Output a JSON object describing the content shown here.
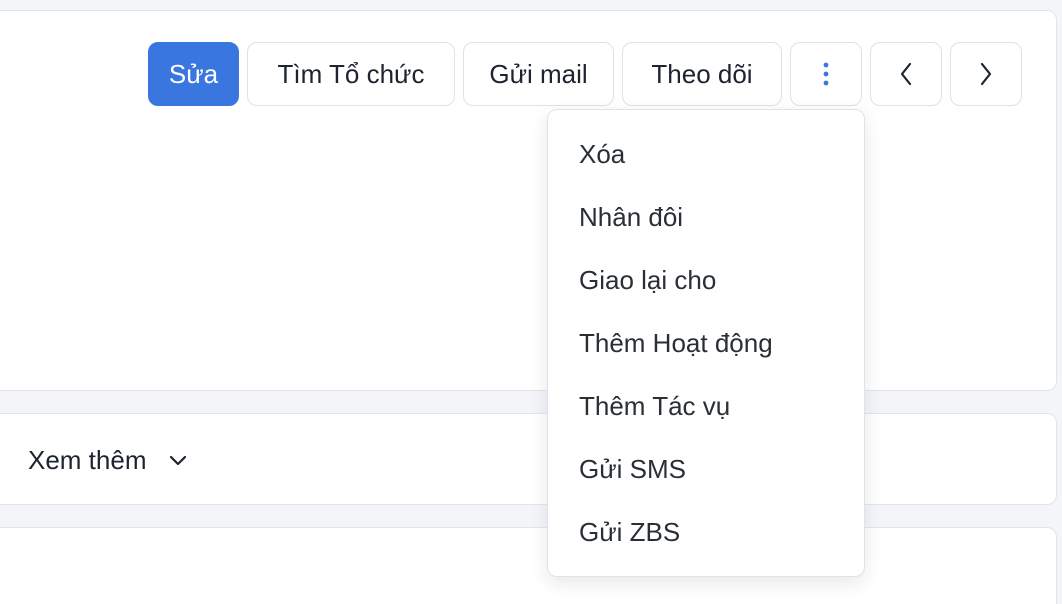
{
  "toolbar": {
    "edit_label": "Sửa",
    "find_org_label": "Tìm Tổ chức",
    "send_mail_label": "Gửi mail",
    "follow_label": "Theo dõi"
  },
  "section": {
    "see_more_label": "Xem thêm"
  },
  "dropdown": {
    "items": [
      {
        "label": "Xóa"
      },
      {
        "label": "Nhân đôi"
      },
      {
        "label": "Giao lại cho"
      },
      {
        "label": "Thêm Hoạt động"
      },
      {
        "label": "Thêm Tác vụ"
      },
      {
        "label": "Gửi SMS"
      },
      {
        "label": "Gửi ZBS"
      }
    ]
  },
  "icons": {
    "more": "vertical-dots-icon",
    "prev": "chevron-left-icon",
    "next": "chevron-right-icon",
    "expand": "chevron-down-icon"
  },
  "colors": {
    "primary": "#3a76e0",
    "page_background": "#f3f5f9"
  }
}
